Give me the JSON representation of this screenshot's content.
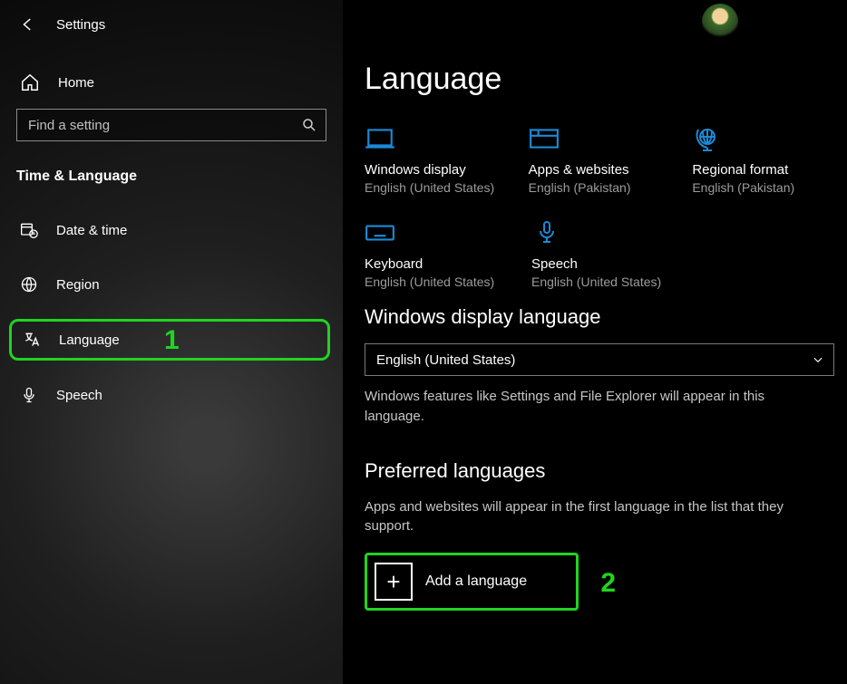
{
  "titlebar": {
    "title": "Settings"
  },
  "sidebar": {
    "home_label": "Home",
    "search_placeholder": "Find a setting",
    "section_heading": "Time & Language",
    "items": [
      {
        "label": "Date & time"
      },
      {
        "label": "Region"
      },
      {
        "label": "Language"
      },
      {
        "label": "Speech"
      }
    ]
  },
  "callouts": {
    "one": "1",
    "two": "2"
  },
  "main": {
    "heading": "Language",
    "tiles": [
      {
        "title": "Windows display",
        "sub": "English (United States)"
      },
      {
        "title": "Apps & websites",
        "sub": "English (Pakistan)"
      },
      {
        "title": "Regional format",
        "sub": "English (Pakistan)"
      },
      {
        "title": "Keyboard",
        "sub": "English (United States)"
      },
      {
        "title": "Speech",
        "sub": "English (United States)"
      }
    ],
    "display_lang_heading": "Windows display language",
    "display_lang_value": "English (United States)",
    "display_lang_desc": "Windows features like Settings and File Explorer will appear in this language.",
    "preferred_heading": "Preferred languages",
    "preferred_desc": "Apps and websites will appear in the first language in the list that they support.",
    "add_language_label": "Add a language"
  }
}
